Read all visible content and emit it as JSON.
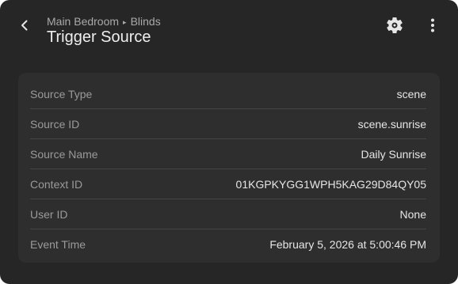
{
  "header": {
    "breadcrumb": [
      "Main Bedroom",
      "Blinds"
    ],
    "breadcrumb_separator": "▸",
    "title": "Trigger Source",
    "icons": {
      "back": "chevron-left-icon",
      "settings": "gear-icon",
      "more": "more-vertical-icon"
    }
  },
  "details": [
    {
      "label": "Source Type",
      "value": "scene"
    },
    {
      "label": "Source ID",
      "value": "scene.sunrise"
    },
    {
      "label": "Source Name",
      "value": "Daily Sunrise"
    },
    {
      "label": "Context ID",
      "value": "01KGPKYGG1WPH5KAG29D84QY05"
    },
    {
      "label": "User ID",
      "value": "None"
    },
    {
      "label": "Event Time",
      "value": "February 5, 2026 at 5:00:46 PM"
    }
  ],
  "colors": {
    "background": "#262626",
    "card": "#2e2e2e",
    "label": "#9a9a9a",
    "value": "#e6e6e6",
    "divider": "#454545"
  }
}
